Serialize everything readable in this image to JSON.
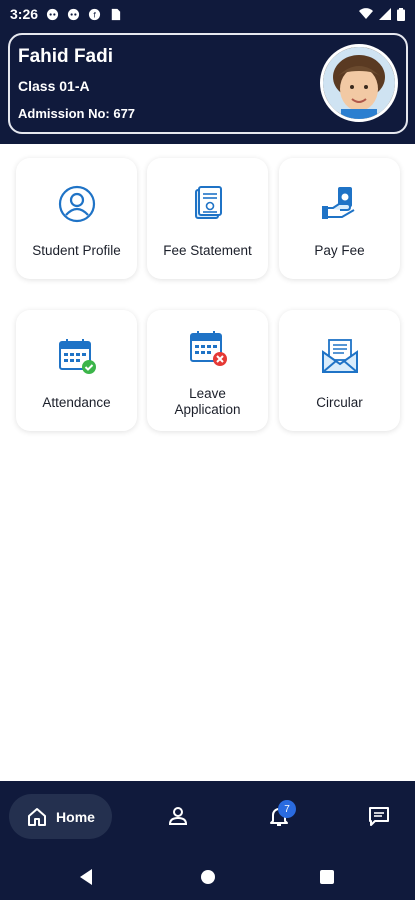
{
  "status_bar": {
    "time": "3:26",
    "icons": [
      "cat-notification-icon",
      "cat-notification-icon",
      "app-notification-icon",
      "sim-icon"
    ],
    "right_icons": [
      "wifi-icon",
      "signal-icon",
      "battery-icon"
    ]
  },
  "profile": {
    "name": "Fahid Fadi",
    "class": "Class 01-A",
    "admission": "Admission No: 677"
  },
  "tiles": [
    {
      "label": "Student Profile",
      "icon": "user-circle-icon"
    },
    {
      "label": "Fee Statement",
      "icon": "document-icon"
    },
    {
      "label": "Pay Fee",
      "icon": "hand-money-icon"
    },
    {
      "label": "Attendance",
      "icon": "calendar-check-icon"
    },
    {
      "label": "Leave Application",
      "label_lines": [
        "Leave",
        "Application"
      ],
      "icon": "calendar-cancel-icon"
    },
    {
      "label": "Circular",
      "icon": "envelope-icon"
    }
  ],
  "bottom_nav": {
    "home_label": "Home",
    "notification_count": "7",
    "items": [
      "home-icon",
      "person-icon",
      "bell-icon",
      "chat-icon"
    ]
  },
  "colors": {
    "header_bg": "#101a3c",
    "accent": "#2a6be0",
    "icon_blue": "#1f73c6"
  }
}
